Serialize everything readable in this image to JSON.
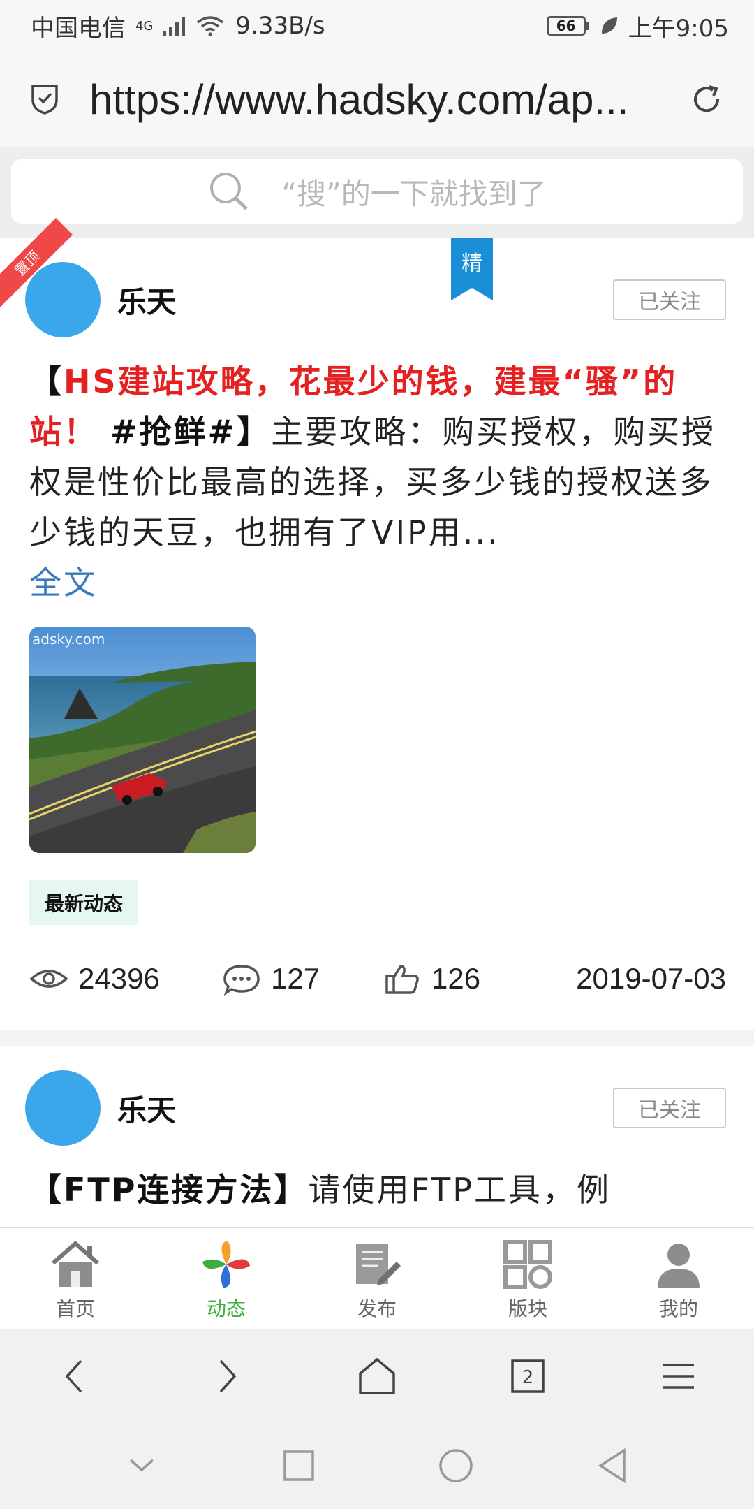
{
  "status_bar": {
    "carrier": "中国电信",
    "network": "4G",
    "speed": "9.33B/s",
    "battery": "66",
    "time": "上午9:05"
  },
  "browser": {
    "url": "https://www.hadsky.com/ap..."
  },
  "search": {
    "placeholder": "“搜”的一下就找到了"
  },
  "posts": [
    {
      "ribbon": "置顶",
      "badge": "精",
      "author": "乐天",
      "follow_label": "已关注",
      "title_open": "【",
      "title_red": "HS建站攻略，花最少的钱，建最“骚”的站！",
      "title_tag": "#抢鲜#",
      "title_close": "】",
      "body": "主要攻略：购买授权，购买授权是性价比最高的选择，买多少钱的授权送多少钱的天豆，也拥有了VIP用...",
      "more_link": "全文",
      "image_watermark": "adsky.com",
      "tag": "最新动态",
      "views": "24396",
      "comments": "127",
      "likes": "126",
      "date": "2019-07-03"
    },
    {
      "author": "乐天",
      "follow_label": "已关注",
      "title": "【FTP连接方法】",
      "body": "请使用FTP工具，例"
    }
  ],
  "app_tabs": [
    {
      "label": "首页",
      "icon": "home-icon"
    },
    {
      "label": "动态",
      "icon": "pinwheel-icon"
    },
    {
      "label": "发布",
      "icon": "compose-icon"
    },
    {
      "label": "版块",
      "icon": "grid-icon"
    },
    {
      "label": "我的",
      "icon": "user-icon"
    }
  ],
  "browser_nav": {
    "tab_count": "2"
  },
  "colors": {
    "accent_red": "#e52020",
    "active_tab": "#3fae3f",
    "link_blue": "#3a7bc0",
    "avatar_blue": "#3aa7ea",
    "badge_blue": "#1a8fd8"
  }
}
